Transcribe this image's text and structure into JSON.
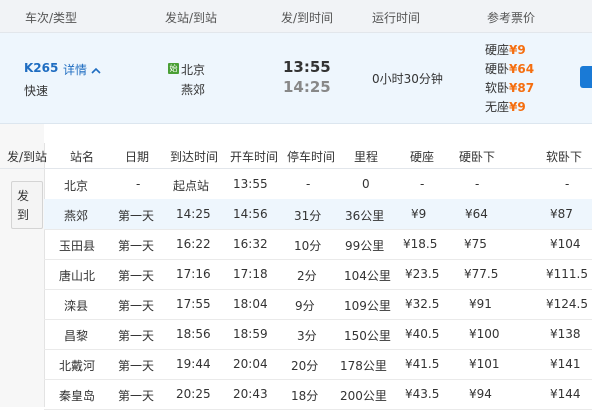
{
  "header": {
    "train_type": "车次/类型",
    "from_to": "发站/到站",
    "dep_arr": "发/到时间",
    "duration": "运行时间",
    "price": "参考票价"
  },
  "train": {
    "number": "K265",
    "detail_link": "详情",
    "type": "快速",
    "start_badge": "始",
    "from": "北京",
    "to": "燕郊",
    "depart": "13:55",
    "arrive": "14:25",
    "duration": "0小时30分钟",
    "prices": [
      {
        "label": "硬座",
        "value": "¥9"
      },
      {
        "label": "硬卧",
        "value": "¥64"
      },
      {
        "label": "软卧",
        "value": "¥87"
      },
      {
        "label": "无座",
        "value": "¥9"
      }
    ]
  },
  "stops": {
    "side_label_1": "发",
    "side_label_2": "到",
    "columns": [
      "发/到站",
      "站名",
      "日期",
      "到达时间",
      "开车时间",
      "停车时间",
      "里程",
      "硬座",
      "硬卧下",
      "软卧下"
    ],
    "rows": [
      [
        "北京",
        "-",
        "起点站",
        "13:55",
        "-",
        "0",
        "-",
        "-",
        "-"
      ],
      [
        "燕郊",
        "第一天",
        "14:25",
        "14:56",
        "31分",
        "36公里",
        "¥9",
        "¥64",
        "¥87"
      ],
      [
        "玉田县",
        "第一天",
        "16:22",
        "16:32",
        "10分",
        "99公里",
        "¥18.5",
        "¥75",
        "¥104"
      ],
      [
        "唐山北",
        "第一天",
        "17:16",
        "17:18",
        "2分",
        "104公里",
        "¥23.5",
        "¥77.5",
        "¥111.5"
      ],
      [
        "滦县",
        "第一天",
        "17:55",
        "18:04",
        "9分",
        "109公里",
        "¥32.5",
        "¥91",
        "¥124.5"
      ],
      [
        "昌黎",
        "第一天",
        "18:56",
        "18:59",
        "3分",
        "150公里",
        "¥40.5",
        "¥100",
        "¥138"
      ],
      [
        "北戴河",
        "第一天",
        "19:44",
        "20:04",
        "20分",
        "178公里",
        "¥41.5",
        "¥101",
        "¥141"
      ],
      [
        "秦皇岛",
        "第一天",
        "20:25",
        "20:43",
        "18分",
        "200公里",
        "¥43.5",
        "¥94",
        "¥144"
      ]
    ]
  }
}
